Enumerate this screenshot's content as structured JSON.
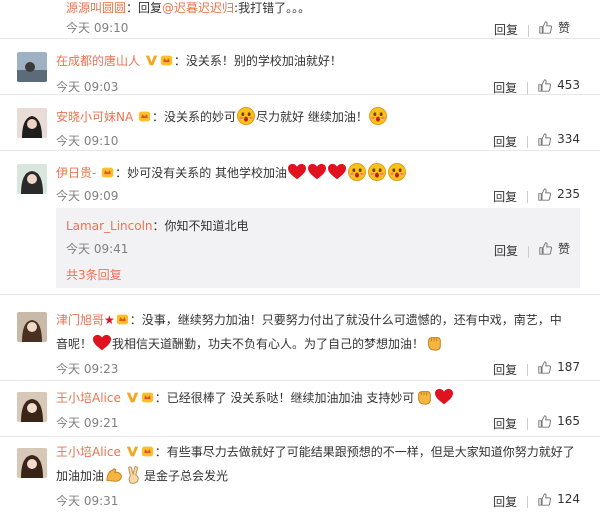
{
  "colors": {
    "accent": "#eb7350",
    "meta": "#808080",
    "reply_bg": "#f2f2f5"
  },
  "top": {
    "user": "源源叫圆圆",
    "prefix": "：回复",
    "mention": "@迟暮迟迟归",
    "text": ":我打错了。。。",
    "time": "今天 09:10",
    "reply": "回复",
    "like": "赞"
  },
  "comments": [
    {
      "user": "在成都的唐山人",
      "text": "没关系！别的学校加油就好！",
      "time": "今天 09:03",
      "reply": "回复",
      "likes": "453"
    },
    {
      "user": "安晓小可妹NA",
      "text1": "没关系的妙可",
      "text2": "尽力就好 继续加油！",
      "time": "今天 09:10",
      "reply": "回复",
      "likes": "334"
    },
    {
      "user": "伊日贵-",
      "text": "妙可没有关系的 其他学校加油",
      "time": "今天 09:09",
      "reply": "回复",
      "likes": "235",
      "sub": {
        "user": "Lamar_Lincoln",
        "text": "你知不知道北电",
        "time": "今天 09:41",
        "reply": "回复",
        "like": "赞",
        "more": "共3条回复"
      }
    },
    {
      "user": "津门旭哥",
      "line1": "没事，继续努力加油！只要努力付出了就没什么可遗憾的，还有中戏，南艺，中",
      "line2a": "音呢！",
      "line2b": "我相信天道酬勤，功夫不负有心人。为了自己的梦想加油！",
      "time": "今天 09:23",
      "reply": "回复",
      "likes": "187"
    },
    {
      "user": "王小培Alice",
      "text": "已经很棒了 没关系哒！继续加油加油 支持妙可",
      "time": "今天 09:21",
      "reply": "回复",
      "likes": "165"
    },
    {
      "user": "王小培Alice",
      "line1": "有些事尽力去做就好了可能结果跟预想的不一样，但是大家知道你努力就好了",
      "line2a": "加油加油",
      "line2b": "是金子总会发光",
      "time": "今天 09:31",
      "reply": "回复",
      "likes": "124"
    }
  ],
  "icons": [
    "thumbs-up-icon",
    "vip-badge-icon",
    "heart-icon",
    "blush-face-icon",
    "fist-icon",
    "muscle-icon",
    "victory-hand-icon"
  ]
}
